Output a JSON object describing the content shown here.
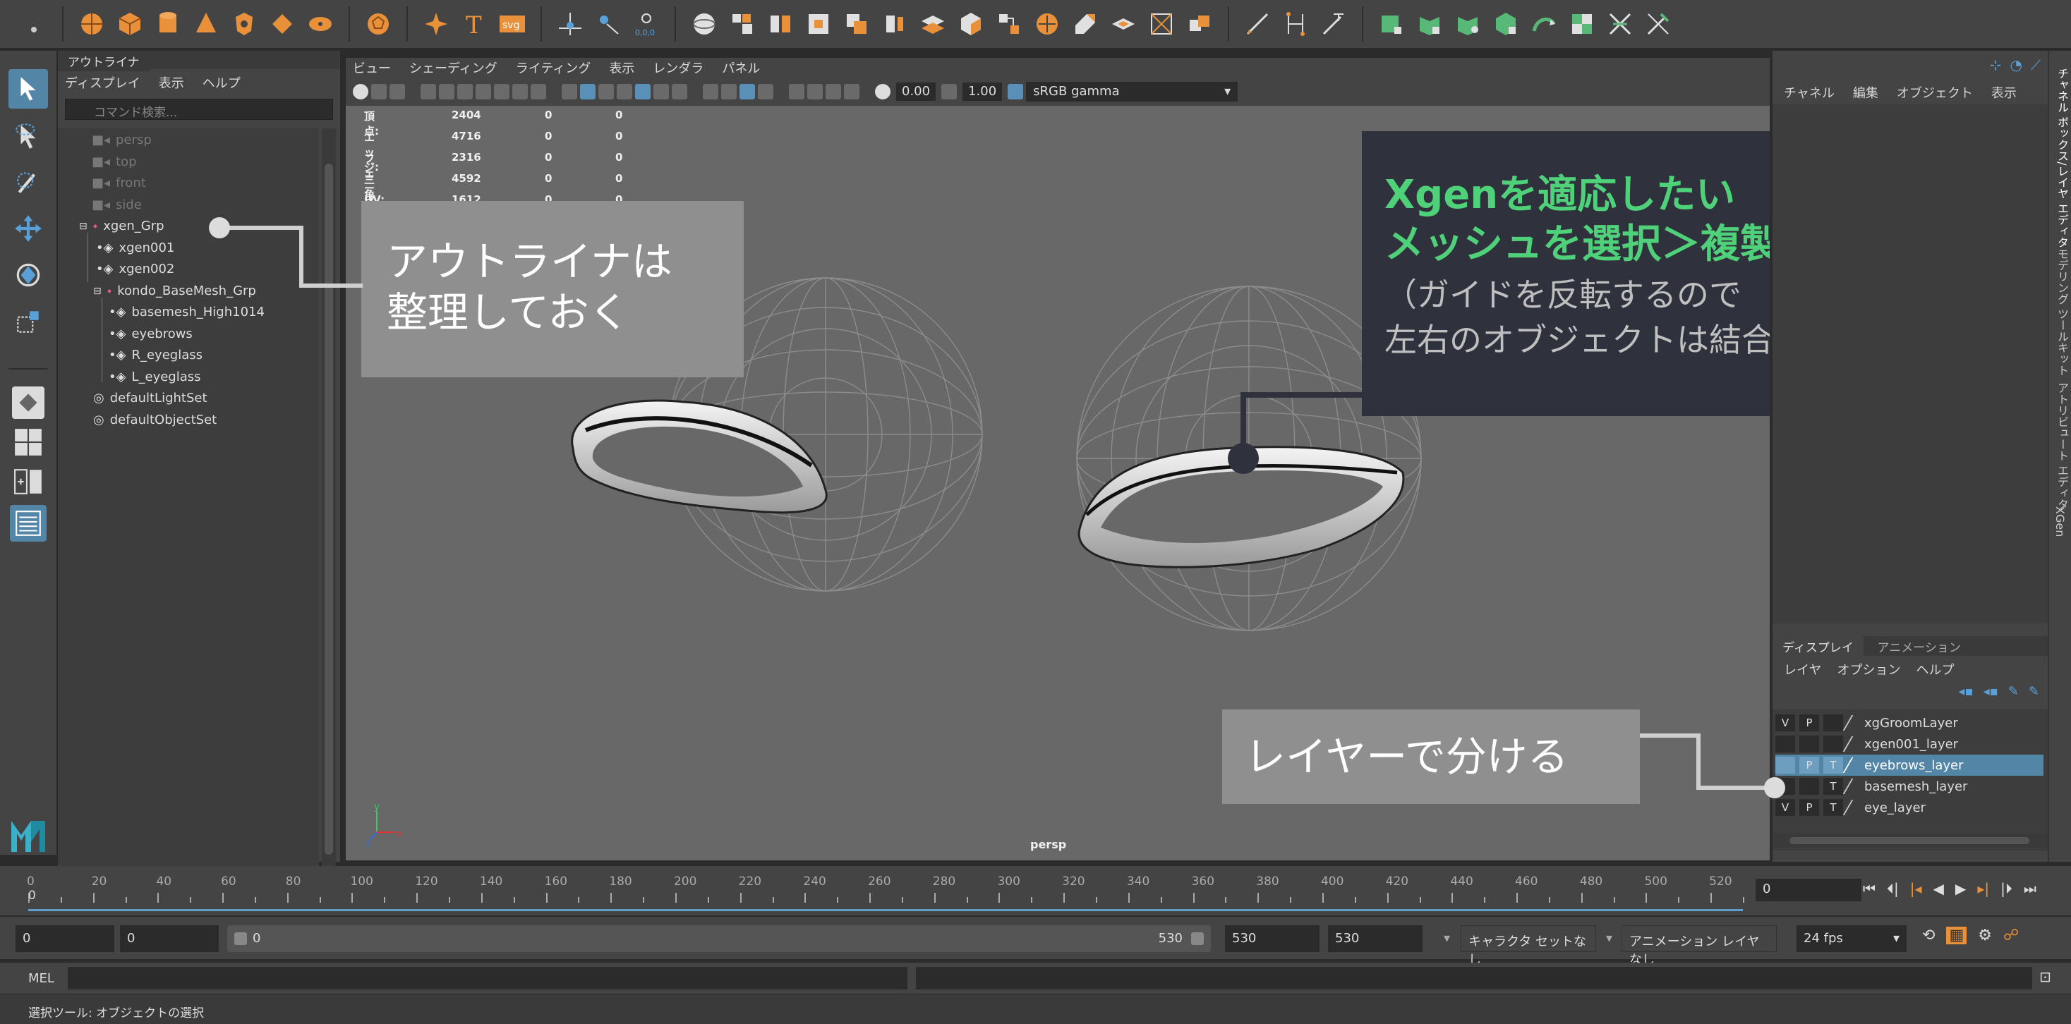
{
  "shelf": {
    "icons": [
      "settings-icon",
      "sphere-icon",
      "cube-icon",
      "cylinder-icon",
      "cone-icon",
      "torus-icon",
      "plane-icon",
      "disc-icon",
      "soccerball-icon",
      "sparkle-icon",
      "type-icon",
      "svg-icon",
      "locator-icon",
      "measure-icon",
      "distance-icon",
      "sphere-wire-icon",
      "combine-icon",
      "separate-icon",
      "extract-icon",
      "booleans-icon",
      "smooth-icon",
      "mirror-icon",
      "extrude-icon",
      "bridge-icon",
      "fill-hole-icon",
      "bevel-icon",
      "target-weld-icon",
      "multi-cut-icon",
      "curve-icon",
      "edge-loop-icon",
      "lasso-icon",
      "uv-icon",
      "ruler-icon",
      "cvs-icon",
      "crease-icon",
      "warp-icon",
      "unfold-icon",
      "checker-icon",
      "xgen-icon",
      "paint-icon"
    ],
    "svg_label": "svg",
    "coord_label": "0,0,0"
  },
  "toolbox": {
    "tools": [
      "select-tool-icon",
      "lasso-tool-icon",
      "paint-select-icon",
      "move-tool-icon",
      "rotate-tool-icon",
      "scale-tool-icon"
    ],
    "layouts": [
      "single-view-icon",
      "four-view-icon",
      "persp-outliner-icon",
      "outliner-layout-icon"
    ]
  },
  "outliner": {
    "tab": "アウトライナ",
    "menu": [
      "ディスプレイ",
      "表示",
      "ヘルプ"
    ],
    "search_placeholder": "コマンド検索...",
    "items": [
      {
        "label": "persp",
        "dim": true
      },
      {
        "label": "top",
        "dim": true
      },
      {
        "label": "front",
        "dim": true
      },
      {
        "label": "side",
        "dim": true
      },
      {
        "label": "xgen_Grp",
        "dim": false
      },
      {
        "label": "xgen001",
        "dim": false
      },
      {
        "label": "xgen002",
        "dim": false
      },
      {
        "label": "kondo_BaseMesh_Grp",
        "dim": false
      },
      {
        "label": "basemesh_High1014",
        "dim": false
      },
      {
        "label": "eyebrows",
        "dim": false
      },
      {
        "label": "R_eyeglass",
        "dim": false
      },
      {
        "label": "L_eyeglass",
        "dim": false
      },
      {
        "label": "defaultLightSet",
        "dim": false
      },
      {
        "label": "defaultObjectSet",
        "dim": false
      }
    ]
  },
  "viewport": {
    "menu": [
      "ビュー",
      "シェーディング",
      "ライティング",
      "表示",
      "レンダラ",
      "パネル"
    ],
    "exposure": "0.00",
    "gamma": "1.00",
    "color_space": "sRGB gamma",
    "camera_label": "persp",
    "hud": [
      {
        "label": "頂点:",
        "values": [
          "2404",
          "0",
          "0"
        ]
      },
      {
        "label": "エッジ:",
        "values": [
          "4716",
          "0",
          "0"
        ]
      },
      {
        "label": "フェース:",
        "values": [
          "2316",
          "0",
          "0"
        ]
      },
      {
        "label": "三角形:",
        "values": [
          "4592",
          "0",
          "0"
        ]
      },
      {
        "label": "UV:",
        "values": [
          "1612",
          "0",
          "0"
        ]
      }
    ]
  },
  "channel_box": {
    "menu": [
      "チャネル",
      "編集",
      "オブジェクト",
      "表示"
    ],
    "side_tabs": [
      "チャネル ボックス/レイヤ エディタ",
      "モデリング ツールキット",
      "アトリビュート エディタ",
      "XGen"
    ]
  },
  "layer_editor": {
    "tabs": [
      "ディスプレイ",
      "アニメーション"
    ],
    "menu": [
      "レイヤ",
      "オプション",
      "ヘルプ"
    ],
    "layers": [
      {
        "v": "V",
        "p": "P",
        "t": "",
        "name": "xgGroomLayer",
        "selected": false
      },
      {
        "v": "",
        "p": "",
        "t": "",
        "name": "xgen001_layer",
        "selected": false
      },
      {
        "v": "",
        "p": "P",
        "t": "T",
        "name": "eyebrows_layer",
        "selected": true
      },
      {
        "v": "",
        "p": "",
        "t": "T",
        "name": "basemesh_layer",
        "selected": false
      },
      {
        "v": "V",
        "p": "P",
        "t": "T",
        "name": "eye_layer",
        "selected": false
      }
    ]
  },
  "timeline": {
    "ticks": [
      "0",
      "20",
      "40",
      "60",
      "80",
      "100",
      "120",
      "140",
      "160",
      "180",
      "200",
      "220",
      "240",
      "260",
      "280",
      "300",
      "320",
      "340",
      "360",
      "380",
      "400",
      "420",
      "440",
      "460",
      "480",
      "500",
      "520"
    ],
    "current_frame": "0",
    "current_field": "0"
  },
  "range": {
    "start": "0",
    "anim_start": "0",
    "slider_start": "0",
    "slider_end": "530",
    "anim_end": "530",
    "end": "530",
    "character_set": "キャラクタ セットなし",
    "anim_layer": "アニメーション レイヤなし",
    "fps": "24 fps"
  },
  "command": {
    "mel_label": "MEL"
  },
  "help_line": "選択ツール: オブジェクトの選択",
  "callouts": {
    "outliner_note": [
      "アウトライナは",
      "整理しておく"
    ],
    "xgen_title": [
      "Xgenを適応したい",
      "メッシュを選択＞複製"
    ],
    "xgen_sub": [
      "（ガイドを反転するので",
      "左右のオブジェクトは結合）"
    ],
    "layer_note": "レイヤーで分ける"
  },
  "colors": {
    "accent_green": "#4fd17a",
    "selection_blue": "#5285a6",
    "callout_gray": "#8a8a8a",
    "callout_dark": "#2f323d"
  }
}
